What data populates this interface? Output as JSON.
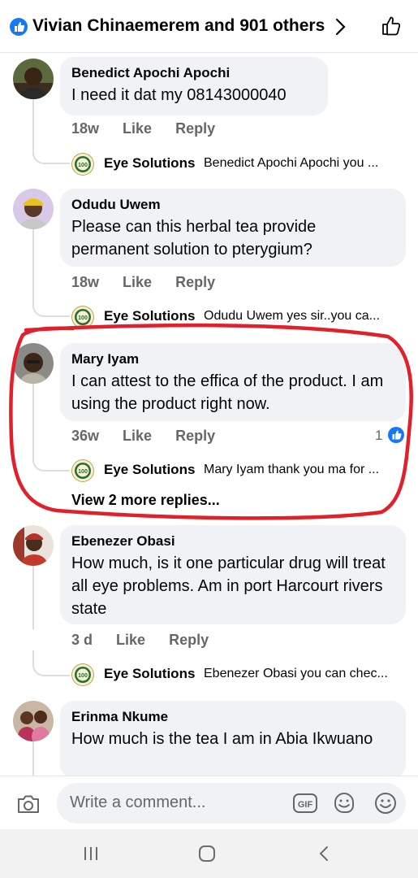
{
  "header": {
    "reactors_text": "Vivian Chinaemerem and 901 others",
    "icons": [
      "like-reaction-icon",
      "chevron-right-icon",
      "thumbs-up-outline-icon"
    ]
  },
  "comments": [
    {
      "author": "Benedict Apochi Apochi",
      "text": "I need it dat my  08143000040",
      "time": "18w",
      "like": "Like",
      "reply": "Reply",
      "reply_preview": {
        "author": "Eye Solutions",
        "snippet": "Benedict Apochi Apochi you ..."
      }
    },
    {
      "author": "Odudu Uwem",
      "text": "Please can this herbal tea provide permanent solution to pterygium?",
      "time": "18w",
      "like": "Like",
      "reply": "Reply",
      "reply_preview": {
        "author": "Eye Solutions",
        "snippet": "Odudu Uwem yes sir..you ca..."
      }
    },
    {
      "author": "Mary Iyam",
      "text": "I can attest to the effica of the product. I am using the product right now.",
      "time": "36w",
      "like": "Like",
      "reply": "Reply",
      "like_count": "1",
      "reply_preview": {
        "author": "Eye Solutions",
        "snippet": "Mary Iyam thank you ma for ..."
      },
      "view_more": "View 2 more replies..."
    },
    {
      "author": "Ebenezer Obasi",
      "text": "How much, is it one particular drug will treat all eye problems. Am in port Harcourt rivers state",
      "time": "3 d",
      "like": "Like",
      "reply": "Reply",
      "reply_preview": {
        "author": "Eye Solutions",
        "snippet": "Ebenezer Obasi you can chec..."
      }
    },
    {
      "author": "Erinma Nkume",
      "text": "How much is the tea I am in Abia Ikwuano"
    }
  ],
  "composer": {
    "placeholder": "Write a comment...",
    "icons": [
      "camera-icon",
      "gif-icon",
      "sticker-icon",
      "emoji-icon"
    ]
  },
  "colors": {
    "facebook_blue": "#1877f2",
    "bubble_bg": "#f0f2f5",
    "secondary_text": "#65676b",
    "annotation_red": "#e0202a",
    "logo_green": "#2e6b2a"
  },
  "navbar": {
    "icons": [
      "recent-apps-icon",
      "home-icon",
      "back-icon"
    ]
  }
}
